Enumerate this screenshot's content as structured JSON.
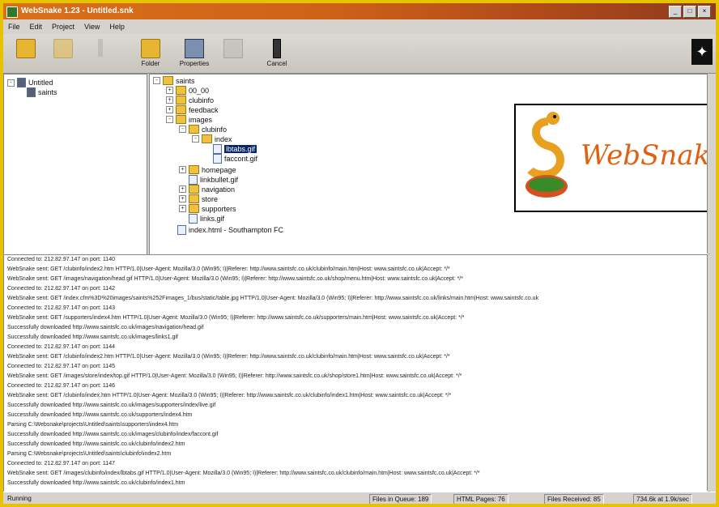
{
  "window": {
    "title": "WebSnake 1.23 - Untitled.snk"
  },
  "title_buttons": {
    "minimize": "_",
    "maximize": "□",
    "close": "×"
  },
  "menu": [
    "File",
    "Edit",
    "Project",
    "View",
    "Help"
  ],
  "toolbar": {
    "items": [
      {
        "label": "",
        "icon": "folder-open-icon"
      },
      {
        "label": "",
        "icon": "save-icon"
      },
      {
        "label": "",
        "icon": "wand-icon"
      },
      {
        "label": "Folder",
        "icon": "folder-icon"
      },
      {
        "label": "Properties",
        "icon": "properties-icon"
      },
      {
        "label": "",
        "icon": "stop-icon"
      },
      {
        "label": "Cancel",
        "icon": "cancel-icon"
      }
    ]
  },
  "project_tree": {
    "root": "Untitled",
    "child": "saints"
  },
  "site_tree": [
    {
      "label": "saints",
      "exp": "-",
      "kind": "folder"
    },
    {
      "label": "00_00",
      "exp": "+",
      "kind": "folder"
    },
    {
      "label": "clubinfo",
      "exp": "+",
      "kind": "folder"
    },
    {
      "label": "feedback",
      "exp": "+",
      "kind": "folder"
    },
    {
      "label": "images",
      "exp": "-",
      "kind": "folder"
    },
    {
      "label": "clubinfo",
      "exp": "-",
      "kind": "folder"
    },
    {
      "label": "index",
      "exp": "-",
      "kind": "folder"
    },
    {
      "label": "lbtabs.gif",
      "exp": "",
      "kind": "file",
      "selected": true
    },
    {
      "label": "faccont.gif",
      "exp": "",
      "kind": "file"
    },
    {
      "label": "homepage",
      "exp": "+",
      "kind": "folder"
    },
    {
      "label": "linkbullet.gif",
      "exp": "",
      "kind": "file"
    },
    {
      "label": "navigation",
      "exp": "+",
      "kind": "folder"
    },
    {
      "label": "store",
      "exp": "+",
      "kind": "folder"
    },
    {
      "label": "supporters",
      "exp": "+",
      "kind": "folder"
    },
    {
      "label": "links.gif",
      "exp": "",
      "kind": "file"
    },
    {
      "label": "index.html - Southampton FC",
      "exp": "",
      "kind": "file"
    }
  ],
  "logo": {
    "text": "WebSnake"
  },
  "log_lines": [
    "Connected to: 212.82.97.147 on port: 1140",
    "WebSnake sent: GET /clubinfo/index2.htm HTTP/1.0|User-Agent: Mozilla/3.0 (Win95; I)|Referer: http://www.saintsfc.co.uk/clubinfo/main.htm|Host: www.saintsfc.co.uk|Accept: */*",
    "WebSnake sent: GET /images/navigation/head.gif HTTP/1.0|User-Agent: Mozilla/3.0 (Win95; I)|Referer: http://www.saintsfc.co.uk/shop/menu.htm|Host: www.saintsfc.co.uk|Accept: */*",
    "Connected to: 212.82.97.147 on port: 1142",
    "WebSnake sent: GET /index.cfm%3D%20images/saints%252Fimages_1/bus/static/table.jpg HTTP/1.0|User-Agent: Mozilla/3.0 (Win95; I)|Referer: http://www.saintsfc.co.uk/links/main.htm|Host: www.saintsfc.co.uk",
    "Connected to: 212.82.97.147 on port: 1143",
    "WebSnake sent: GET /supporters/index4.htm HTTP/1.0|User-Agent: Mozilla/3.0 (Win95; I)|Referer: http://www.saintsfc.co.uk/supporters/main.htm|Host: www.saintsfc.co.uk|Accept: */*",
    "     Successfully downloaded http://www.saintsfc.co.uk/images/navigation/head.gif",
    "     Successfully downloaded http://www.saintsfc.co.uk/images/links1.gif",
    "Connected to: 212.82.97.147 on port: 1144",
    "WebSnake sent: GET /clubinfo/index2.htm HTTP/1.0|User-Agent: Mozilla/3.0 (Win95; I)|Referer: http://www.saintsfc.co.uk/clubinfo/main.htm|Host: www.saintsfc.co.uk|Accept: */*",
    "Connected to: 212.82.97.147 on port: 1145",
    "WebSnake sent: GET /images/store/index/top.gif HTTP/1.0|User-Agent: Mozilla/3.0 (Win95; I)|Referer: http://www.saintsfc.co.uk/shop/store1.htm|Host: www.saintsfc.co.uk|Accept: */*",
    "Connected to: 212.82.97.147 on port: 1146",
    "WebSnake sent: GET /clubinfo/index.htm HTTP/1.0|User-Agent: Mozilla/3.0 (Win95; I)|Referer: http://www.saintsfc.co.uk/clubinfo/index1.htm|Host: www.saintsfc.co.uk|Accept: */*",
    "     Successfully downloaded http://www.saintsfc.co.uk/images/supporters/index/live.gif",
    "     Successfully downloaded http://www.saintsfc.co.uk/supporters/index4.htm",
    "     Parsing C:\\Websnake\\projects\\Untitled\\saints\\supporters\\index4.htm",
    "     Successfully downloaded http://www.saintsfc.co.uk/images/clubinfo/index/faccont.gif",
    "     Successfully downloaded http://www.saintsfc.co.uk/clubinfo/index2.htm",
    "     Parsing C:\\Websnake\\projects\\Untitled\\saints\\clubinfo\\index2.htm",
    "Connected to: 212.82.97.147 on port: 1147",
    "WebSnake sent: GET /images/clubinfo/index/lbtabs.gif HTTP/1.0|User-Agent: Mozilla/3.0 (Win95; I)|Referer: http://www.saintsfc.co.uk/clubinfo/main.htm|Host: www.saintsfc.co.uk|Accept: */*",
    "     Successfully downloaded http://www.saintsfc.co.uk/clubinfo/index1.htm"
  ],
  "status": {
    "state": "Running",
    "queue": "Files in Queue: 189",
    "html": "HTML Pages: 76",
    "received": "Files Received: 85",
    "kb": "734.6k at 1.9k/sec"
  }
}
